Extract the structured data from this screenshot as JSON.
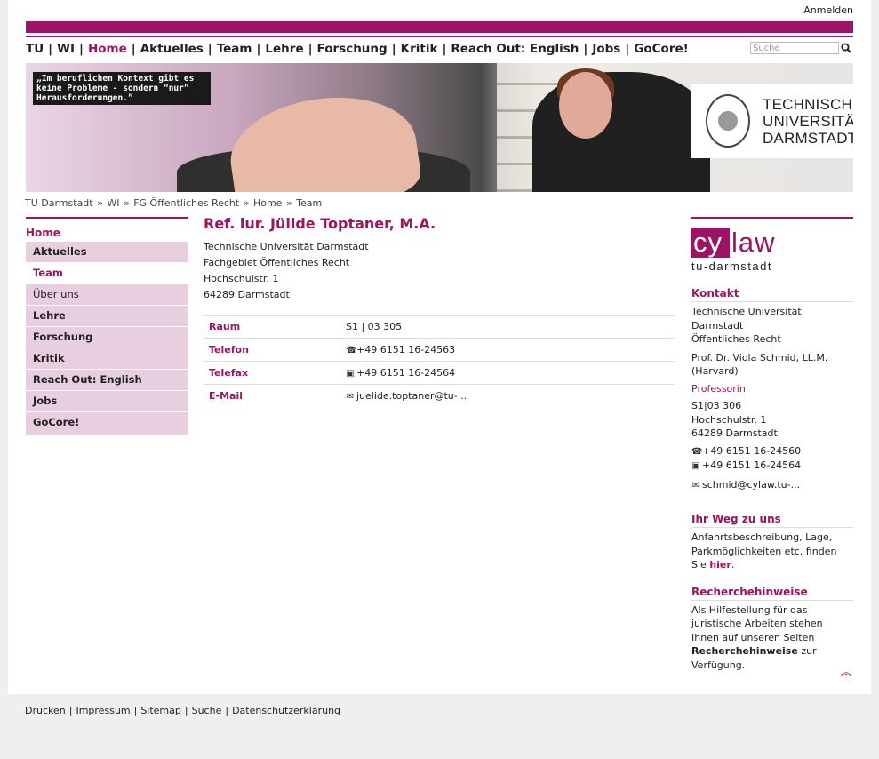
{
  "header": {
    "login": "Anmelden",
    "search_placeholder": "Suche"
  },
  "mainnav": [
    "TU",
    "WI",
    "Home",
    "Aktuelles",
    "Team",
    "Lehre",
    "Forschung",
    "Kritik",
    "Reach Out: English",
    "Jobs",
    "GoCore!"
  ],
  "hero": {
    "quote": "„Im beruflichen Kontext gibt es keine Probleme - sondern “nur” Herausforderungen.”",
    "logo_lines": [
      "TECHNISCHE",
      "UNIVERSITÄT",
      "DARMSTADT"
    ]
  },
  "breadcrumb": [
    "TU Darmstadt",
    "WI",
    "FG Öffentliches Recht",
    "Home",
    "Team"
  ],
  "leftnav": {
    "home": "Home",
    "items": [
      "Aktuelles",
      "Team",
      "Über uns",
      "Lehre",
      "Forschung",
      "Kritik",
      "Reach Out: English",
      "Jobs",
      "GoCore!"
    ]
  },
  "person": {
    "name": "Ref. iur. Jülide Toptaner, M.A.",
    "address": [
      "Technische Universität Darmstadt",
      "Fachgebiet Öffentliches Recht",
      "Hochschulstr. 1",
      "64289 Darmstadt"
    ],
    "rows": [
      {
        "label": "Raum",
        "value": "S1 | 03 305"
      },
      {
        "label": "Telefon",
        "value": "+49 6151 16-24563"
      },
      {
        "label": "Telefax",
        "value": "+49 6151 16-24564"
      },
      {
        "label": "E-Mail",
        "value": "juelide.toptaner@tu-..."
      }
    ]
  },
  "sidebar": {
    "logo_cy": "cy",
    "logo_law": "law",
    "logo_sub": "tu-darmstadt",
    "kontakt": {
      "title": "Kontakt",
      "org": [
        "Technische Universität Darmstadt",
        "Öffentliches Recht"
      ],
      "name": [
        "Prof. Dr. Viola Schmid, LL.M.",
        "(Harvard)"
      ],
      "role": "Professorin",
      "address": [
        "S1|03 306",
        "Hochschulstr. 1",
        "64289 Darmstadt"
      ],
      "phone": "+49 6151 16-24560",
      "fax": "+49 6151 16-24564",
      "email": "schmid@cylaw.tu-..."
    },
    "weg": {
      "title": "Ihr Weg zu uns",
      "text": "Anfahrtsbeschreibung, Lage, Parkmöglichkeiten etc. finden Sie",
      "link": "hier",
      "end": "."
    },
    "recherche": {
      "title": "Recherchehinweise",
      "text": "Als Hilfestellung für das juristische Arbeiten stehen Ihnen auf unseren Seiten",
      "link": "Recherchehinweise",
      "end": "zur Verfügung."
    }
  },
  "footer": [
    "Drucken",
    "Impressum",
    "Sitemap",
    "Suche",
    "Datenschutzerklärung"
  ],
  "colors": {
    "accent": "#9c1464",
    "nav_bg": "#e8cfe0",
    "page_bg": "#efefef"
  }
}
